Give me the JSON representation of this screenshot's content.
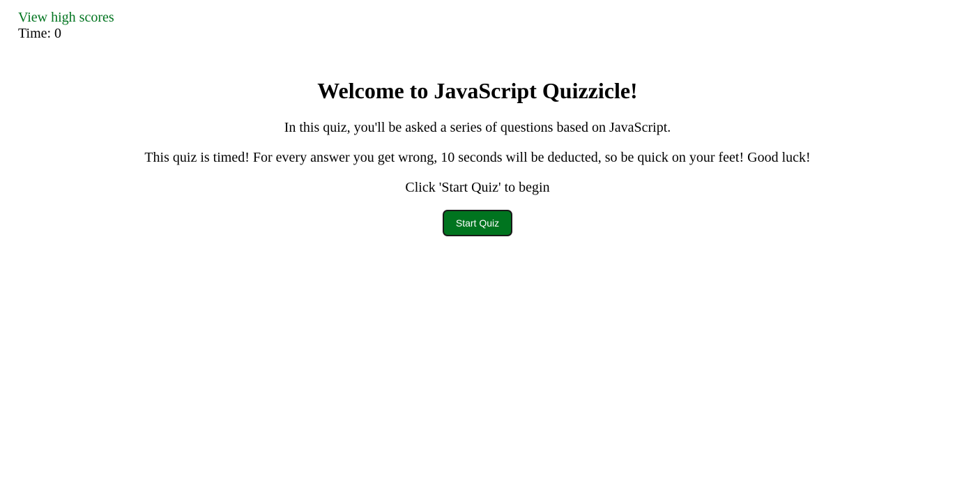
{
  "header": {
    "high_scores_label": "View high scores",
    "timer_label": "Time: 0"
  },
  "main": {
    "title": "Welcome to JavaScript Quizzicle!",
    "intro": "In this quiz, you'll be asked a series of questions based on JavaScript.",
    "rules": "This quiz is timed! For every answer you get wrong, 10 seconds will be deducted, so be quick on your feet! Good luck!",
    "instruction": "Click 'Start Quiz' to begin",
    "start_button_label": "Start Quiz"
  },
  "colors": {
    "accent": "#00741f",
    "button_text": "#ffffff",
    "button_border": "#1a1a1a"
  }
}
